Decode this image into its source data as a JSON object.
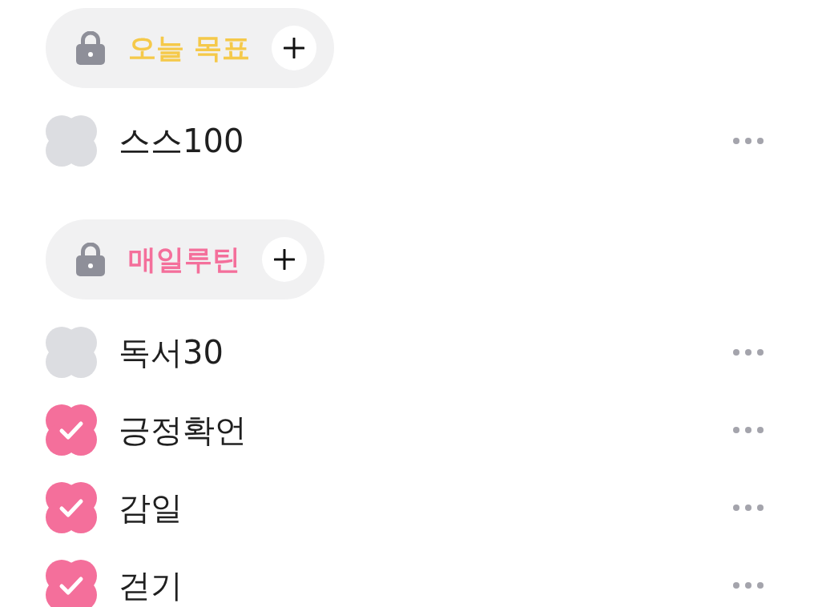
{
  "sections": [
    {
      "title": "오늘 목표",
      "color": "#f5c94a",
      "items": [
        {
          "label": "스스100",
          "checked": false
        }
      ]
    },
    {
      "title": "매일루틴",
      "color": "#f46f9b",
      "items": [
        {
          "label": "독서30",
          "checked": false
        },
        {
          "label": "긍정확언",
          "checked": true
        },
        {
          "label": "감일",
          "checked": true
        },
        {
          "label": "걷기",
          "checked": true
        }
      ]
    }
  ]
}
